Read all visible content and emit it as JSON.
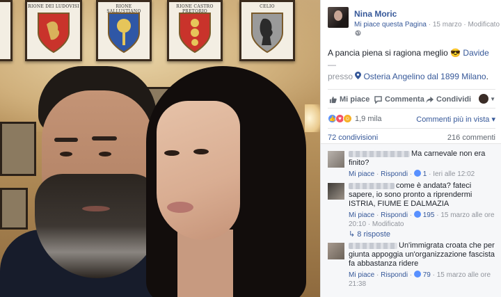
{
  "post": {
    "author": "Nina Moric",
    "like_page": "Mi piace questa Pagina",
    "date": "15 marzo",
    "edited": "Modificato",
    "text": "A pancia piena si ragiona meglio",
    "emoji": "😎",
    "tag_name": "Davide",
    "dash": "—",
    "presso": "presso",
    "place": "Osteria Angelino dal 1899 Milano",
    "place_suffix": "."
  },
  "photo": {
    "frames": [
      {
        "caption": ""
      },
      {
        "caption": "RIONE DEI LUDOVISI"
      },
      {
        "caption": "RIONE SALLUSTIANO"
      },
      {
        "caption": "RIONE CASTRO PRETORIO"
      },
      {
        "caption": "CELIO"
      }
    ]
  },
  "actions": {
    "like": "Mi piace",
    "comment": "Commenta",
    "share": "Condividi"
  },
  "reactions": {
    "count": "1,9 mila",
    "view": "Commenti più in vista",
    "view_caret": "▾"
  },
  "stats": {
    "shares": "72 condivisioni",
    "comments": "216 commenti"
  },
  "comments": [
    {
      "text": "Ma carnevale non era finito?",
      "like": "Mi piace",
      "reply": "Rispondi",
      "likes": "1",
      "time": "Ieri alle 12:02",
      "edited": ""
    },
    {
      "text": "come è andata? fateci sapere, io sono pronto a riprendermi ISTRIA, FIUME E DALMAZIA",
      "like": "Mi piace",
      "reply": "Rispondi",
      "likes": "195",
      "time": "15 marzo alle ore 20:10",
      "edited": "Modificato"
    },
    {
      "text": "Un'immigrata croata che per giunta appoggia un'organizzazione fascista fa abbastanza ridere",
      "like": "Mi piace",
      "reply": "Rispondi",
      "likes": "79",
      "time": "15 marzo alle ore 21:38",
      "edited": ""
    }
  ],
  "replies": {
    "arrow": "↳",
    "label": "8 risposte"
  },
  "colors": {
    "link": "#365899",
    "meta": "#90949c",
    "like_blue": "#5890ff",
    "love_red": "#f25268",
    "haha_yellow": "#f7b125"
  }
}
